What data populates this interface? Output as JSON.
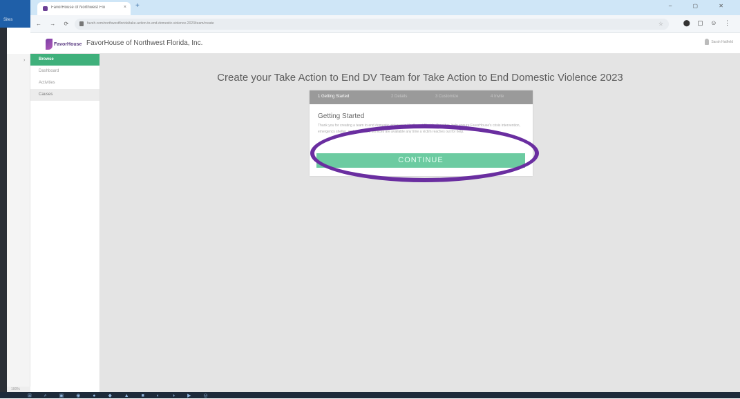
{
  "os": {
    "sidebar_label": "Sites"
  },
  "browser": {
    "tab_title": "FavorHouse of Northwest Flo",
    "tab_close": "×",
    "new_tab": "+",
    "window_controls": "– ▢ ✕",
    "nav_icons": "← → ⟳",
    "url": "faveh.com/northwestflorida/take-action-to-end-domestic-violence-2023/team/create",
    "star": "☆",
    "extension_icons": "⬤ ▢ ☺ ⋮"
  },
  "header": {
    "logo_text": "FavorHouse",
    "org_name": "FavorHouse of Northwest Florida, Inc.",
    "user_label": "Sarah Hatfield"
  },
  "sidebar": {
    "items": [
      {
        "label": "Browse"
      },
      {
        "label": "Dashboard"
      },
      {
        "label": "Activities"
      },
      {
        "label": "Causes"
      }
    ]
  },
  "main": {
    "title": "Create your Take Action to End DV Team for Take Action to End Domestic Violence 2023",
    "wizard": {
      "steps": [
        "1 Getting Started",
        "2 Details",
        "3 Customize",
        "4 Invite"
      ],
      "heading": "Getting Started",
      "body": "Thank you for creating a team to end domestic violence in Northwest Florida. Together, help ensure FavorHouse's crisis intervention, emergency shelter, and supportive services are available any time a victim reaches out for help.",
      "continue_label": "CONTINUE"
    }
  },
  "footer": {
    "zoom": "100%",
    "taskbar_icons": "⊞ ⌕ ▣ ◉ ● ◆ ▲ ■ ◐ ◑ ▶ ◎"
  },
  "colors": {
    "accent_green": "#3fb07b",
    "button_green": "#6ccba1",
    "ring_purple": "#6a2ea0"
  }
}
